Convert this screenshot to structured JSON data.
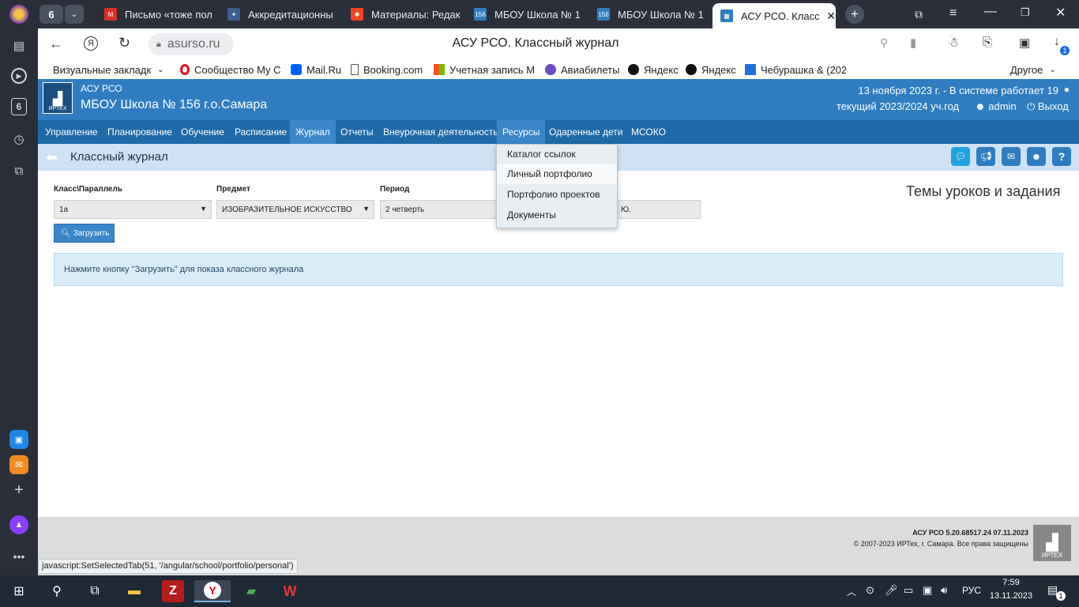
{
  "browser": {
    "tab_count": "6",
    "tabs": [
      {
        "title": "Письмо «тоже пол"
      },
      {
        "title": "Аккредитационны"
      },
      {
        "title": "Материалы: Редак"
      },
      {
        "title": "МБОУ Школа № 1"
      },
      {
        "title": "МБОУ Школа № 1"
      },
      {
        "title": "АСУ РСО. Класс"
      }
    ],
    "url": "asurso.ru",
    "page_title": "АСУ РСО. Классный журнал",
    "download_badge": "1",
    "bookmarks": [
      {
        "label": "Визуальные закладк"
      },
      {
        "label": "Сообщество My C"
      },
      {
        "label": "Mail.Ru"
      },
      {
        "label": "Booking.com"
      },
      {
        "label": "Учетная запись M"
      },
      {
        "label": "Авиабилеты"
      },
      {
        "label": "Яндекс"
      },
      {
        "label": "Яндекс"
      },
      {
        "label": "Чебурашка & (202"
      }
    ],
    "bookmarks_other": "Другое",
    "sidebar_badge": "6",
    "status_url": "javascript:SetSelectedTab(51, '/angular/school/portfolio/personal')"
  },
  "site": {
    "brand_small": "АСУ РСО",
    "school_name": "МБОУ Школа № 156 г.о.Самара",
    "logo_text": "ИРТЕХ",
    "date_info": "13 ноября 2023 г. - В системе работает 19",
    "year_info": "текущий 2023/2024 уч.год",
    "user": "admin",
    "logout": "Выход",
    "nav": [
      "Управление",
      "Планирование",
      "Обучение",
      "Расписание",
      "Журнал",
      "Отчеты",
      "Внеурочная деятельность",
      "Ресурсы",
      "Одаренные дети",
      "МСОКО"
    ],
    "page_heading": "Классный журнал",
    "dropdown": [
      "Каталог ссылок",
      "Личный портфолио",
      "Портфолио проектов",
      "Документы"
    ],
    "filters": {
      "class_label": "Класс\\Параллель",
      "class_value": "1а",
      "subject_label": "Предмет",
      "subject_value": "ИЗОБРАЗИТЕЛЬНОЕ ИСКУССТВО",
      "period_label": "Период",
      "period_value": "2 четверть",
      "teacher_tail": "Ю."
    },
    "load_button": "Загрузить",
    "topics_link": "Темы уроков и задания",
    "info_message": "Нажмите кнопку \"Загрузить\" для показа классного журнала",
    "footer_version": "АСУ РСО  5.20.68517.24  07.11.2023",
    "footer_copyright": "© 2007-2023 ИРТех, г. Самара. Все права защищены",
    "footer_logo": "ИРТЕХ"
  },
  "taskbar": {
    "lang": "РУС",
    "time": "7:59",
    "date": "13.11.2023",
    "notif_count": "1"
  },
  "colors": {
    "header_blue": "#2f7dc0",
    "nav_blue": "#1f6aa8",
    "subheader": "#cfe2f3",
    "info_bg": "#d9ecf7"
  }
}
